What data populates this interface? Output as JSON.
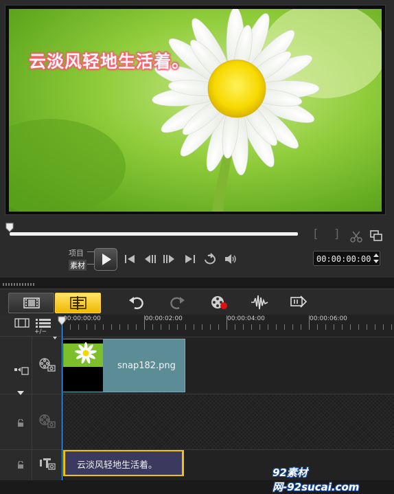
{
  "preview": {
    "title_text": "云淡风轻地生活着。",
    "mark_in_label": "[",
    "mark_out_label": "]"
  },
  "controls": {
    "mode_project": "项目",
    "mode_clip": "素材",
    "timecode": "00:00:00:00"
  },
  "timeline": {
    "ruler_ticks": [
      "00:00:00:00",
      "00:00:02:00",
      "00:00:04:00",
      "00:00:06:00"
    ],
    "add_remove_label": "+/−"
  },
  "video_track": {
    "clip_name": "snap182.png"
  },
  "title_track": {
    "clip_text": "云淡风轻地生活着。"
  },
  "watermark": "92素材网-92sucai.com",
  "colors": {
    "accent_yellow": "#f5c400",
    "clip_teal": "#5c8c95",
    "title_clip_bg": "#3b3a5e",
    "playhead_blue": "#4aa7ff"
  },
  "icons": {
    "storyboard": "filmstrip-icon",
    "timeline": "timeline-icon",
    "undo": "undo-icon",
    "redo": "redo-icon",
    "record": "record-capture-icon",
    "audio": "audio-waveform-icon",
    "auto_music": "auto-music-icon"
  }
}
